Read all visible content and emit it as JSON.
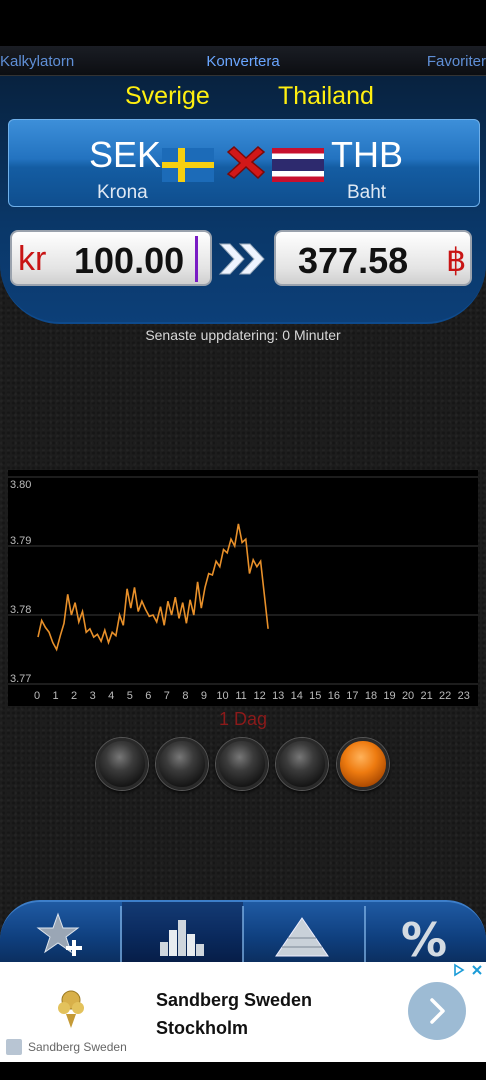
{
  "nav": {
    "left": "Kalkylatorn",
    "center": "Konvertera",
    "right": "Favoriter"
  },
  "converter": {
    "from": {
      "country": "Sverige",
      "code": "SEK",
      "name": "Krona",
      "symbol": "kr",
      "amount": "100.00"
    },
    "to": {
      "country": "Thailand",
      "code": "THB",
      "name": "Baht",
      "symbol": "฿",
      "amount": "377.58"
    },
    "last_update": "Senaste uppdatering: 0 Minuter"
  },
  "chart_data": {
    "type": "line",
    "title": "",
    "period_label": "1 Dag",
    "x_ticks": [
      "0",
      "1",
      "2",
      "3",
      "4",
      "5",
      "6",
      "7",
      "8",
      "9",
      "10",
      "11",
      "12",
      "13",
      "14",
      "15",
      "16",
      "17",
      "18",
      "19",
      "20",
      "21",
      "22",
      "23"
    ],
    "y_ticks": [
      "3.80",
      "3.79",
      "3.78",
      "3.77"
    ],
    "xlim": [
      0,
      23.5
    ],
    "ylim": [
      3.77,
      3.8
    ],
    "grid": true,
    "series": [
      {
        "color": "#e8902a",
        "x": [
          0,
          0.2,
          0.4,
          0.6,
          0.8,
          1.0,
          1.2,
          1.4,
          1.6,
          1.8,
          2.0,
          2.2,
          2.4,
          2.6,
          2.8,
          3.0,
          3.2,
          3.4,
          3.6,
          3.8,
          4.0,
          4.2,
          4.4,
          4.6,
          4.8,
          5.0,
          5.2,
          5.4,
          5.6,
          5.8,
          6.0,
          6.2,
          6.4,
          6.6,
          6.8,
          7.0,
          7.2,
          7.4,
          7.6,
          7.8,
          8.0,
          8.2,
          8.4,
          8.6,
          8.8,
          9.0,
          9.2,
          9.4,
          9.6,
          9.8,
          10.0,
          10.2,
          10.4,
          10.6,
          10.8,
          11.0,
          11.2,
          11.4,
          11.6,
          11.8,
          12.0,
          12.2,
          12.4
        ],
        "y": [
          3.7768,
          3.7792,
          3.7782,
          3.7775,
          3.776,
          3.775,
          3.777,
          3.7788,
          3.783,
          3.78,
          3.7818,
          3.779,
          3.7805,
          3.7775,
          3.778,
          3.7768,
          3.7772,
          3.7762,
          3.7778,
          3.776,
          3.7775,
          3.777,
          3.78,
          3.7785,
          3.7838,
          3.781,
          3.784,
          3.7805,
          3.782,
          3.7808,
          3.7798,
          3.78,
          3.779,
          3.7812,
          3.7785,
          3.782,
          3.78,
          3.7826,
          3.7795,
          3.7818,
          3.7788,
          3.7822,
          3.78,
          3.7848,
          3.781,
          3.784,
          3.786,
          3.7858,
          3.7878,
          3.787,
          3.7895,
          3.789,
          3.791,
          3.79,
          3.7932,
          3.7905,
          3.791,
          3.786,
          3.788,
          3.787,
          3.7878,
          3.783,
          3.778
        ]
      }
    ]
  },
  "range_buttons": [
    {
      "name": "range-button-1",
      "active": false
    },
    {
      "name": "range-button-2",
      "active": false
    },
    {
      "name": "range-button-3",
      "active": false
    },
    {
      "name": "range-button-4",
      "active": false
    },
    {
      "name": "range-button-5",
      "active": true
    }
  ],
  "tabs": [
    {
      "name": "tab-add-favorite",
      "icon": "star-plus-icon"
    },
    {
      "name": "tab-chart",
      "icon": "bar-chart-icon",
      "selected": true
    },
    {
      "name": "tab-pyramid",
      "icon": "pyramid-icon"
    },
    {
      "name": "tab-percent",
      "icon": "percent-icon"
    }
  ],
  "ad": {
    "title": "Sandberg Sweden Stockholm",
    "source": "Sandberg Sweden",
    "choices_icon": "ad-choices-icon",
    "next_icon": "chevron-right-icon"
  }
}
